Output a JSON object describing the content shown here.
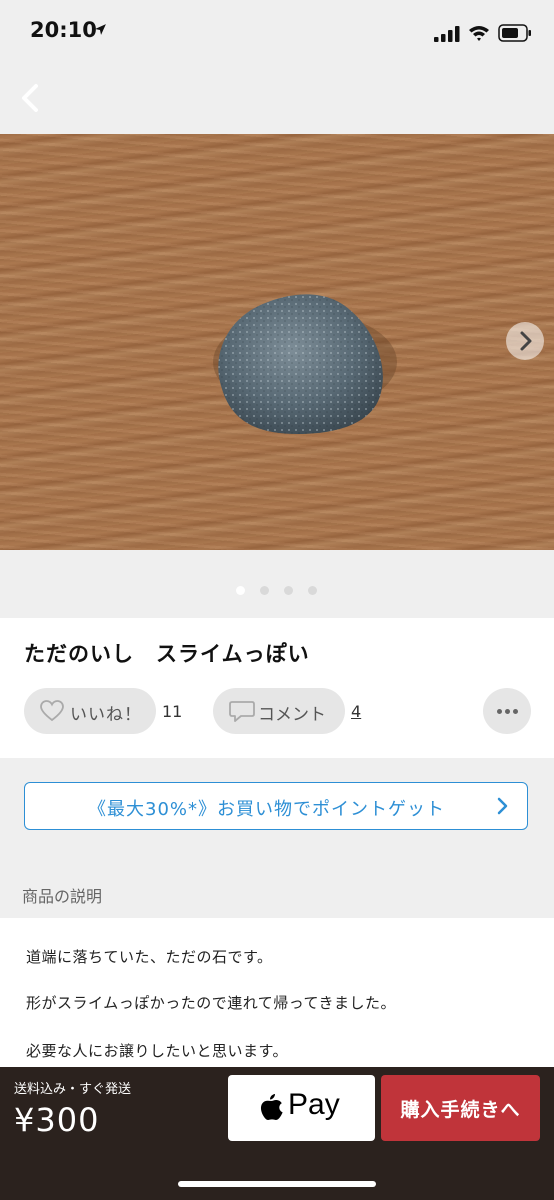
{
  "status_bar": {
    "time": "20:10"
  },
  "product": {
    "title": "ただのいし　スライムっぽい",
    "image_count": 4,
    "active_image": 1
  },
  "actions": {
    "like_label": "いいね！",
    "like_count": "11",
    "comment_label": "コメント",
    "comment_count": "4"
  },
  "promo": {
    "text": "《最大30%*》お買い物でポイントゲット"
  },
  "description": {
    "heading": "商品の説明",
    "lines": [
      "道端に落ちていた、ただの石です。",
      "形がスライムっぽかったので連れて帰ってきました。",
      "必要な人にお譲りしたいと思います。"
    ]
  },
  "purchase": {
    "shipping": "送料込み・すぐ発送",
    "price": "¥300",
    "apple_pay_label": "Pay",
    "buy_label": "購入手続きへ"
  },
  "colors": {
    "accent_blue": "#2d8fd5",
    "buy_red": "#c0343a",
    "bottom_bar": "#2b221e"
  }
}
